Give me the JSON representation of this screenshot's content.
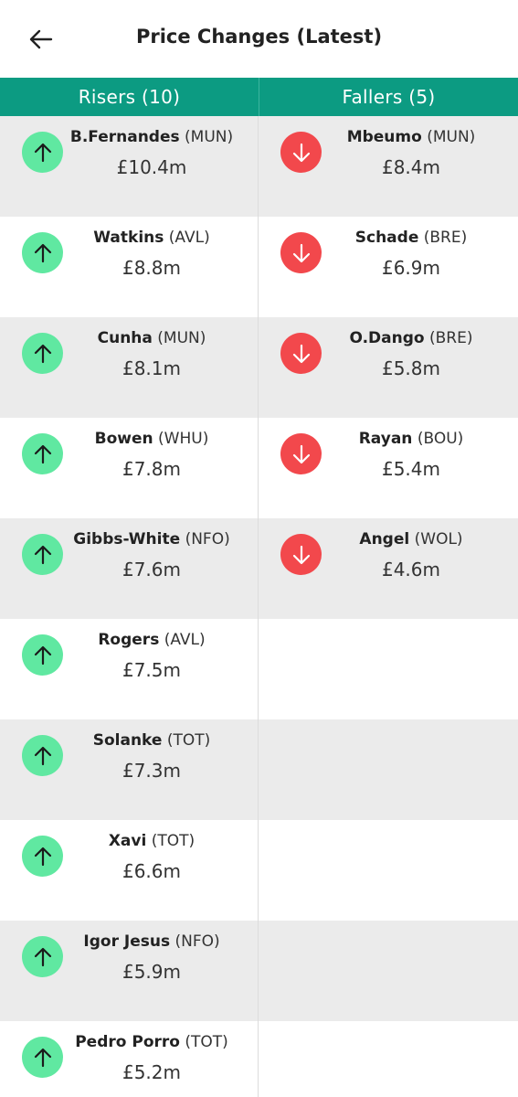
{
  "header": {
    "title": "Price Changes (Latest)"
  },
  "columns": {
    "risers": "Risers (10)",
    "fallers": "Fallers (5)"
  },
  "risers": [
    {
      "name": "B.Fernandes",
      "team": "(MUN)",
      "price": "£10.4m"
    },
    {
      "name": "Watkins",
      "team": "(AVL)",
      "price": "£8.8m"
    },
    {
      "name": "Cunha",
      "team": "(MUN)",
      "price": "£8.1m"
    },
    {
      "name": "Bowen",
      "team": "(WHU)",
      "price": "£7.8m"
    },
    {
      "name": "Gibbs-White",
      "team": "(NFO)",
      "price": "£7.6m"
    },
    {
      "name": "Rogers",
      "team": "(AVL)",
      "price": "£7.5m"
    },
    {
      "name": "Solanke",
      "team": "(TOT)",
      "price": "£7.3m"
    },
    {
      "name": "Xavi",
      "team": "(TOT)",
      "price": "£6.6m"
    },
    {
      "name": "Igor Jesus",
      "team": "(NFO)",
      "price": "£5.9m"
    },
    {
      "name": "Pedro Porro",
      "team": "(TOT)",
      "price": "£5.2m"
    }
  ],
  "fallers": [
    {
      "name": "Mbeumo",
      "team": "(MUN)",
      "price": "£8.4m"
    },
    {
      "name": "Schade",
      "team": "(BRE)",
      "price": "£6.9m"
    },
    {
      "name": "O.Dango",
      "team": "(BRE)",
      "price": "£5.8m"
    },
    {
      "name": "Rayan",
      "team": "(BOU)",
      "price": "£5.4m"
    },
    {
      "name": "Angel",
      "team": "(WOL)",
      "price": "£4.6m"
    }
  ],
  "colors": {
    "accent": "#0c9b82",
    "up": "#60e8a1",
    "down": "#f2484c",
    "alt_row": "#ebebeb"
  },
  "icons": {
    "back": "arrow-left-icon",
    "up": "arrow-up-icon",
    "down": "arrow-down-icon"
  }
}
